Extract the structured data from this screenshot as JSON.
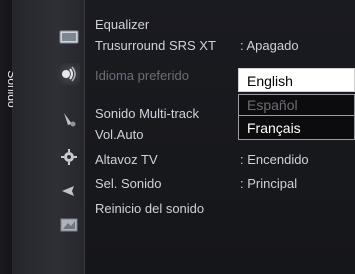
{
  "sidebar": {
    "category_label": "Sonido"
  },
  "icons": [
    {
      "name": "picture-icon"
    },
    {
      "name": "sound-icon"
    },
    {
      "name": "channel-icon"
    },
    {
      "name": "settings-icon"
    },
    {
      "name": "input-icon"
    },
    {
      "name": "application-icon"
    }
  ],
  "menu": {
    "items": [
      {
        "label": "Equalizer",
        "value": ""
      },
      {
        "label": "Trusurround SRS XT",
        "value": ": Apagado"
      },
      {
        "label": "Idioma preferido",
        "value": ":"
      },
      {
        "label": "Sonido Multi-track",
        "value": ":"
      },
      {
        "label": "Vol.Auto",
        "value": ":"
      },
      {
        "label": "Altavoz TV",
        "value": ": Encendido"
      },
      {
        "label": "Sel. Sonido",
        "value": ": Principal"
      },
      {
        "label": "Reinicio del sonido",
        "value": ""
      }
    ]
  },
  "dropdown": {
    "options": [
      "English",
      "Español",
      "Français"
    ],
    "selected": "English"
  }
}
